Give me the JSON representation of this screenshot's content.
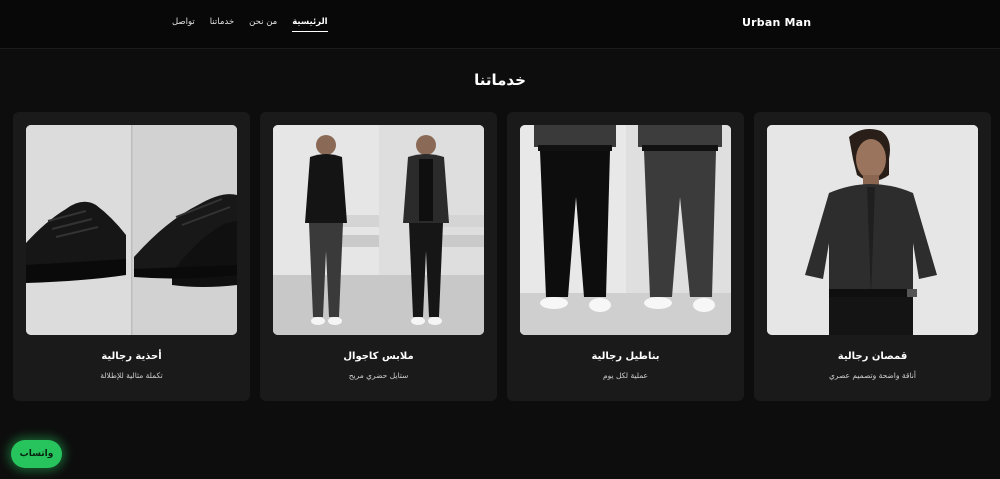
{
  "header": {
    "brand": "Urban Man",
    "nav": [
      {
        "label": "تواصل"
      },
      {
        "label": "خدماتنا"
      },
      {
        "label": "من نحن"
      },
      {
        "label": "الرئيسية",
        "active": true
      }
    ]
  },
  "services": {
    "title": "خدماتنا",
    "cards": [
      {
        "title": "أحذية رجالية",
        "description": "تكملة مثالية للإطلالة"
      },
      {
        "title": "ملابس كاجوال",
        "description": "ستايل حضري مريح"
      },
      {
        "title": "بناطيل رجالية",
        "description": "عملية لكل يوم"
      },
      {
        "title": "قمصان رجالية",
        "description": "أناقة واضحة وتصميم عصري"
      }
    ]
  },
  "whatsapp": {
    "label": "واتساب"
  },
  "colors": {
    "background": "#0d0d0d",
    "card": "#1a1a1a",
    "accent": "#27c35d"
  }
}
